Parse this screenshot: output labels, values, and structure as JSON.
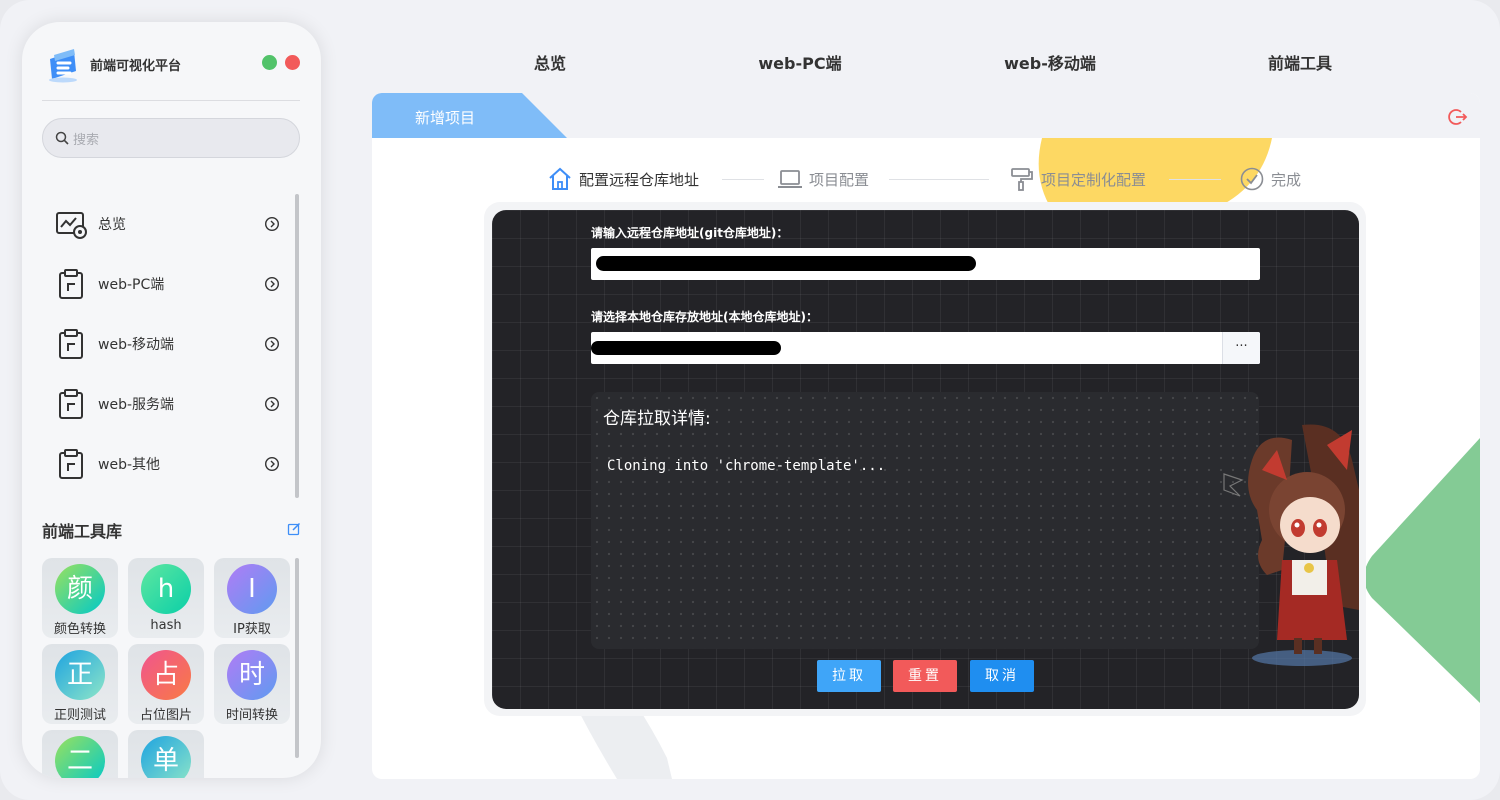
{
  "app": {
    "name": "前端可视化平台"
  },
  "search": {
    "placeholder": "搜索"
  },
  "sidebar": {
    "items": [
      {
        "label": "总览",
        "icon": "dashboard-eye-icon"
      },
      {
        "label": "web-PC端",
        "icon": "clipboard-icon"
      },
      {
        "label": "web-移动端",
        "icon": "clipboard-icon"
      },
      {
        "label": "web-服务端",
        "icon": "clipboard-icon"
      },
      {
        "label": "web-其他",
        "icon": "clipboard-icon"
      }
    ]
  },
  "toolbox": {
    "title": "前端工具库",
    "tools": [
      {
        "glyph": "颜",
        "label": "颜色转换",
        "colors": [
          "#9be15d",
          "#00c9c9"
        ]
      },
      {
        "glyph": "h",
        "label": "hash",
        "colors": [
          "#5ee7a0",
          "#0acfa8"
        ]
      },
      {
        "glyph": "I",
        "label": "IP获取",
        "colors": [
          "#b07cf5",
          "#5f9bf0"
        ]
      },
      {
        "glyph": "正",
        "label": "正则测试",
        "colors": [
          "#1ea3e0",
          "#8ee6c8"
        ]
      },
      {
        "glyph": "占",
        "label": "占位图片",
        "colors": [
          "#f0558f",
          "#f97a44"
        ]
      },
      {
        "glyph": "时",
        "label": "时间转换",
        "colors": [
          "#b07cf5",
          "#5f9bf0"
        ]
      },
      {
        "glyph": "二",
        "label": "",
        "colors": [
          "#9be15d",
          "#00c9c9"
        ]
      },
      {
        "glyph": "单",
        "label": "",
        "colors": [
          "#1ea3e0",
          "#8ee6c8"
        ]
      }
    ]
  },
  "topnav": {
    "items": [
      "总览",
      "web-PC端",
      "web-移动端",
      "前端工具"
    ]
  },
  "panel": {
    "tab": "新增项目",
    "steps": [
      {
        "label": "配置远程仓库地址",
        "icon": "home-icon",
        "active": true
      },
      {
        "label": "项目配置",
        "icon": "laptop-icon",
        "active": false
      },
      {
        "label": "项目定制化配置",
        "icon": "paint-roller-icon",
        "active": false
      },
      {
        "label": "完成",
        "icon": "check-circle-icon",
        "active": false
      }
    ],
    "form": {
      "repo_label": "请输入远程仓库地址(git仓库地址)：",
      "local_label": "请选择本地仓库存放地址(本地仓库地址)：",
      "browse_label": "···"
    },
    "log": {
      "title": "仓库拉取详情:",
      "lines": [
        "Cloning into 'chrome-template'..."
      ]
    },
    "buttons": {
      "pull": "拉取",
      "reset": "重置",
      "cancel": "取消"
    }
  },
  "colors": {
    "accent_blue": "#3e8ef7",
    "tab_blue": "#7fbcf8",
    "step_active": "#333333",
    "step_inactive": "#8a8d93",
    "btn_pull": "#3fa5f8",
    "btn_reset": "#f25a5a",
    "btn_cancel": "#1f8ef0",
    "deco_yellow": "#fdd863",
    "deco_green": "#84cb95"
  }
}
